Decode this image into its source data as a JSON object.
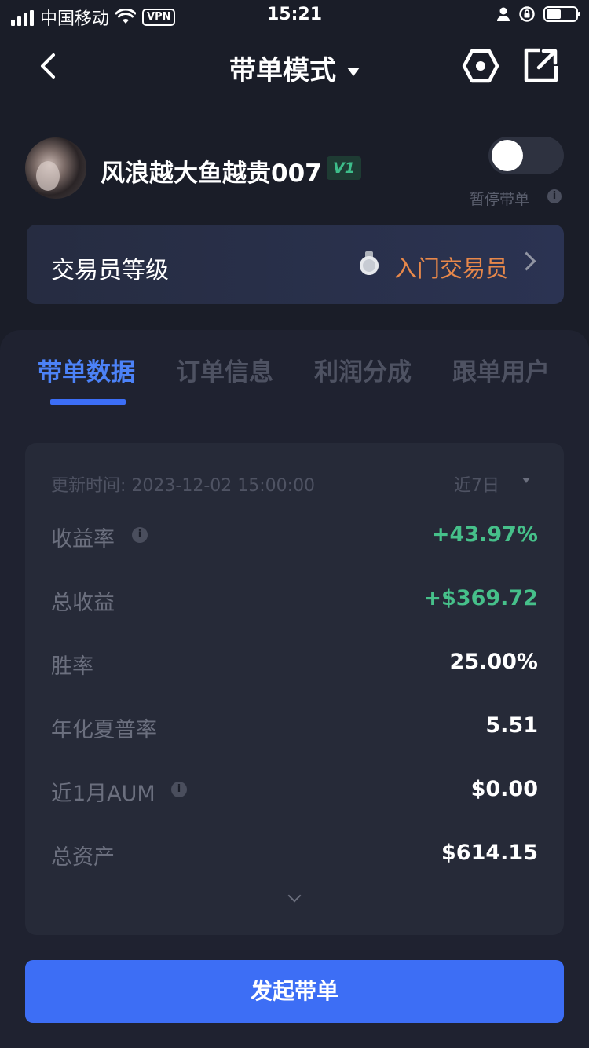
{
  "status_bar": {
    "carrier": "中国移动",
    "vpn": "VPN",
    "time": "15:21"
  },
  "nav": {
    "title": "带单模式"
  },
  "profile": {
    "username": "风浪越大鱼越贵007",
    "badge": "V1",
    "toggle_on": false,
    "toggle_label": "暂停带单"
  },
  "level": {
    "title": "交易员等级",
    "value": "入门交易员",
    "value_color": "#e8884a"
  },
  "tabs": [
    {
      "label": "带单数据",
      "active": true
    },
    {
      "label": "订单信息",
      "active": false
    },
    {
      "label": "利润分成",
      "active": false
    },
    {
      "label": "跟单用户",
      "active": false
    }
  ],
  "stats": {
    "updated": "更新时间: 2023-12-02 15:00:00",
    "range": "近7日",
    "rows": [
      {
        "label": "收益率",
        "value": "+43.97%",
        "info": true,
        "color": "#46c08a"
      },
      {
        "label": "总收益",
        "value": "+$369.72",
        "info": false,
        "color": "#46c08a"
      },
      {
        "label": "胜率",
        "value": "25.00%",
        "info": false,
        "color": "#ffffff"
      },
      {
        "label": "年化夏普率",
        "value": "5.51",
        "info": false,
        "color": "#ffffff"
      },
      {
        "label": "近1月AUM",
        "value": "$0.00",
        "info": true,
        "color": "#ffffff"
      },
      {
        "label": "总资产",
        "value": "$614.15",
        "info": false,
        "color": "#ffffff"
      }
    ]
  },
  "cta": {
    "label": "发起带单"
  },
  "colors": {
    "accent": "#3d6ef5",
    "background": "#1a1d28",
    "positive": "#46c08a"
  }
}
